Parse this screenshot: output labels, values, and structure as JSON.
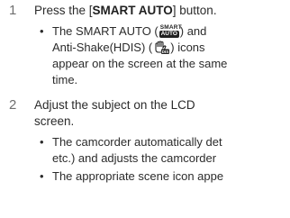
{
  "steps": [
    {
      "number": "1",
      "text_before": "Press the [",
      "bold": "SMART AUTO",
      "text_after": "] button.",
      "bullets": [
        {
          "line1_a": "The SMART AUTO (",
          "line1_b": ") and",
          "line2_a": "Anti-Shake(HDIS) (",
          "line2_b": ") icons",
          "line3": "appear on the screen at the same",
          "line4": "time."
        }
      ]
    },
    {
      "number": "2",
      "line1": "Adjust the subject on the LCD",
      "line2": "screen.",
      "bullets": [
        {
          "line1": "The camcorder automatically det",
          "line2": "etc.) and adjusts the camcorder"
        },
        {
          "line1": "The appropriate scene icon appe"
        }
      ]
    }
  ],
  "icons": {
    "smart_auto": {
      "top_text": "SMART",
      "box_text": "AUTO"
    },
    "anti_shake": {
      "name": "hdis-hand-icon",
      "sub_text": "DIS"
    }
  }
}
